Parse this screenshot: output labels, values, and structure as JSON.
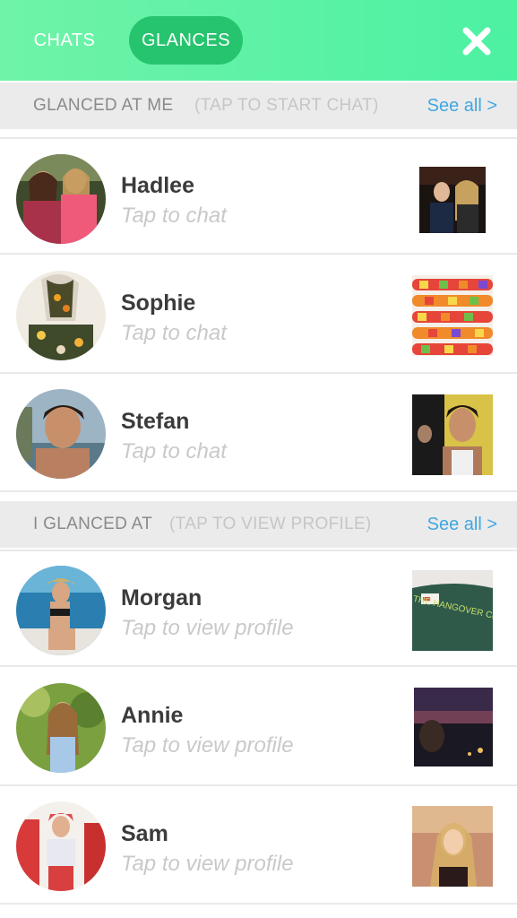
{
  "header": {
    "tabs": [
      {
        "label": "CHATS",
        "active": false
      },
      {
        "label": "GLANCES",
        "active": true
      }
    ],
    "close_icon": "close-icon",
    "accent_color": "#5ef2a6",
    "active_tab_color": "#27c46f"
  },
  "glanced_at_me": {
    "title": "GLANCED AT ME",
    "hint": "(TAP TO START CHAT)",
    "see_all": "See all >",
    "items": [
      {
        "name": "Hadlee",
        "subtitle": "Tap to chat"
      },
      {
        "name": "Sophie",
        "subtitle": "Tap to chat"
      },
      {
        "name": "Stefan",
        "subtitle": "Tap to chat"
      }
    ]
  },
  "i_glanced_at": {
    "title": "I GLANCED AT",
    "hint": "(TAP TO VIEW PROFILE)",
    "see_all": "See all >",
    "items": [
      {
        "name": "Morgan",
        "subtitle": "Tap to view profile"
      },
      {
        "name": "Annie",
        "subtitle": "Tap to view profile"
      },
      {
        "name": "Sam",
        "subtitle": "Tap to view profile"
      }
    ]
  },
  "thumb_text": {
    "shirt": "THE HANGOVER CLUB"
  },
  "colors": {
    "link": "#3fa7e0",
    "section_bg": "#ebebeb",
    "name_text": "#3b3b3b",
    "subtitle_text": "#c9c9c9"
  }
}
